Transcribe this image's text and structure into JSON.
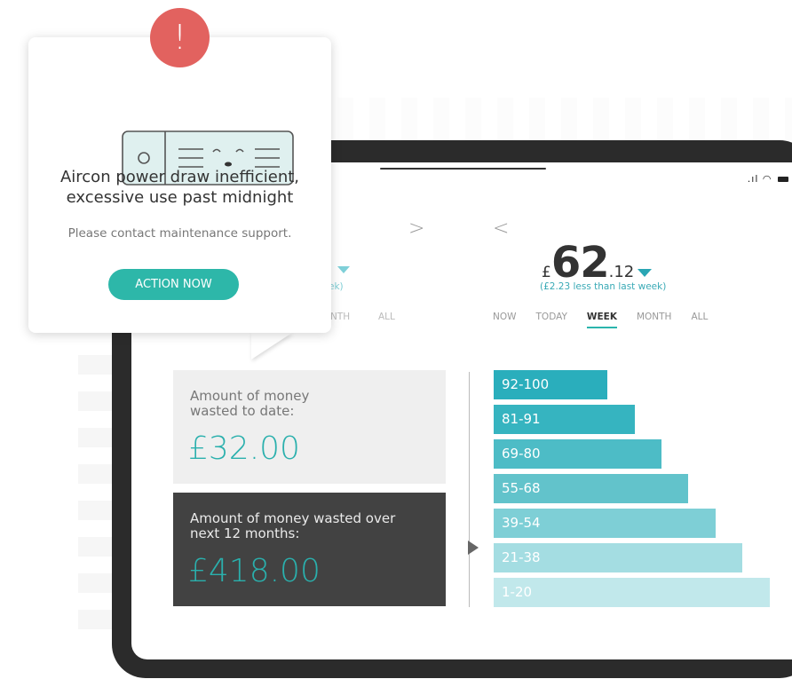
{
  "notification": {
    "alert_glyph": "!",
    "title_line1": "Aircon power draw inefficient,",
    "title_line2": "excessive use past midnight",
    "message": "Please contact maintenance support.",
    "action_label": "ACTION NOW"
  },
  "period_view": {
    "prev_chevron": "<",
    "next_chevron": ">",
    "currency_symbol": "£",
    "amount_major": "62",
    "amount_minor": ".12",
    "comparison": "(£2.23 less than last week)",
    "tabs": [
      "NOW",
      "TODAY",
      "WEEK",
      "MONTH",
      "ALL"
    ],
    "active_tab": "WEEK",
    "ghost_tabs": [
      "NTH",
      "ALL"
    ],
    "ghost_subtext": "ek)"
  },
  "cards": {
    "wasted_to_date_label": "Amount of money wasted to date:",
    "wasted_to_date_value": "£32.00",
    "wasted_next_12_label": "Amount of money wasted over next 12 months:",
    "wasted_next_12_value": "£418.00"
  },
  "efficiency_bands": [
    {
      "label": "92-100",
      "color": "#2aaebc"
    },
    {
      "label": "81-91",
      "color": "#36b4c0"
    },
    {
      "label": "69-80",
      "color": "#4dbcc6"
    },
    {
      "label": "55-68",
      "color": "#62c3cb"
    },
    {
      "label": "39-54",
      "color": "#7ecfd6"
    },
    {
      "label": "21-38",
      "color": "#a4dde2"
    },
    {
      "label": "1-20",
      "color": "#c1e8eb"
    }
  ],
  "colors": {
    "accent": "#2bb5ad",
    "alert": "#e2625f",
    "dark_card": "#424242"
  }
}
